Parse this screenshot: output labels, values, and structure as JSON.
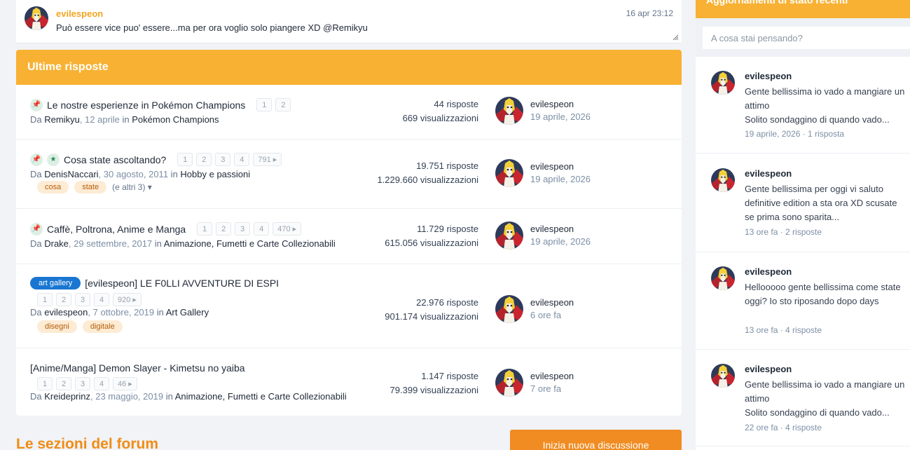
{
  "chat": {
    "author": "evilespeon",
    "time": "16 apr 23:12",
    "message": "Può essere vice puo' essere...ma per ora voglio solo piangere XD @Remikyu"
  },
  "replies": {
    "header": "Ultime risposte",
    "rows": [
      {
        "title": "Le nostre esperienze in Pokémon Champions",
        "pages": [
          "1",
          "2"
        ],
        "by_prefix": "Da ",
        "author": "Remikyu",
        "date": ", 12 aprile",
        "in_word": " in ",
        "forum": "Pokémon Champions",
        "replies": "44 risposte",
        "views": "669 visualizzazioni",
        "last_user": "evilespeon",
        "last_date": "19 aprile, 2026"
      },
      {
        "title": "Cosa state ascoltando?",
        "pages": [
          "1",
          "2",
          "3",
          "4",
          "791 ▸"
        ],
        "by_prefix": "Da ",
        "author": "DenisNaccari",
        "date": ", 30 agosto, 2011",
        "in_word": " in ",
        "forum": "Hobby e passioni",
        "tags": [
          "cosa",
          "state"
        ],
        "tags_more": "(e altri 3) ▾",
        "replies": "19.751 risposte",
        "views": "1.229.660 visualizzazioni",
        "last_user": "evilespeon",
        "last_date": "19 aprile, 2026"
      },
      {
        "title": "Caffè, Poltrona, Anime e Manga",
        "pages": [
          "1",
          "2",
          "3",
          "4",
          "470 ▸"
        ],
        "by_prefix": "Da ",
        "author": "Drake",
        "date": ", 29 settembre, 2017",
        "in_word": " in ",
        "forum": "Animazione, Fumetti e Carte Collezionabili",
        "replies": "11.729 risposte",
        "views": "615.056 visualizzazioni",
        "last_user": "evilespeon",
        "last_date": "19 aprile, 2026"
      },
      {
        "badge": "art gallery",
        "title": "[evilespeon] LE F0LLI AVVENTURE DI ESPI",
        "pages": [
          "1",
          "2",
          "3",
          "4",
          "920 ▸"
        ],
        "by_prefix": "Da ",
        "author": "evilespeon",
        "date": ", 7 ottobre, 2019",
        "in_word": " in ",
        "forum": "Art Gallery",
        "tags": [
          "disegni",
          "digitale"
        ],
        "replies": "22.976 risposte",
        "views": "901.174 visualizzazioni",
        "last_user": "evilespeon",
        "last_date": "6 ore fa"
      },
      {
        "title": "[Anime/Manga] Demon Slayer - Kimetsu no yaiba",
        "pages": [
          "1",
          "2",
          "3",
          "4",
          "46 ▸"
        ],
        "by_prefix": "Da ",
        "author": "Kreideprinz",
        "date": ", 23 maggio, 2019",
        "in_word": " in ",
        "forum": "Animazione, Fumetti e Carte Collezionabili",
        "replies": "1.147 risposte",
        "views": "79.399 visualizzazioni",
        "last_user": "evilespeon",
        "last_date": "7 ore fa"
      }
    ]
  },
  "sections_title": "Le sezioni del forum",
  "new_discussion_label": "Inizia nuova discussione",
  "sidebar": {
    "header": "Aggiornamenti di stato recenti",
    "input_placeholder": "A cosa stai pensando?",
    "statuses": [
      {
        "user": "evilespeon",
        "text": "Gente bellissima io vado a mangiare un attimo",
        "text2": "Solito sondaggino di quando vado...",
        "meta": "19 aprile, 2026 · 1 risposta"
      },
      {
        "user": "evilespeon",
        "text": "Gente bellissima per oggi vi saluto definitive edition a sta ora XD scusate se prima sono sparita...",
        "meta": "13 ore fa · 2 risposte"
      },
      {
        "user": "evilespeon",
        "text": "Hellooooo gente bellissima come state oggi? Io sto riposando dopo days",
        "meta": "13 ore fa · 4 risposte"
      },
      {
        "user": "evilespeon",
        "text": "Gente bellissima io vado a mangiare un attimo",
        "text2": "Solito sondaggino di quando vado...",
        "meta": "22 ore fa · 4 risposte"
      }
    ]
  },
  "colors": {
    "accent": "#f8b133",
    "button": "#f08c22",
    "author": "#f3a521",
    "pin": "#2b8a54",
    "badge": "#1976d2"
  }
}
